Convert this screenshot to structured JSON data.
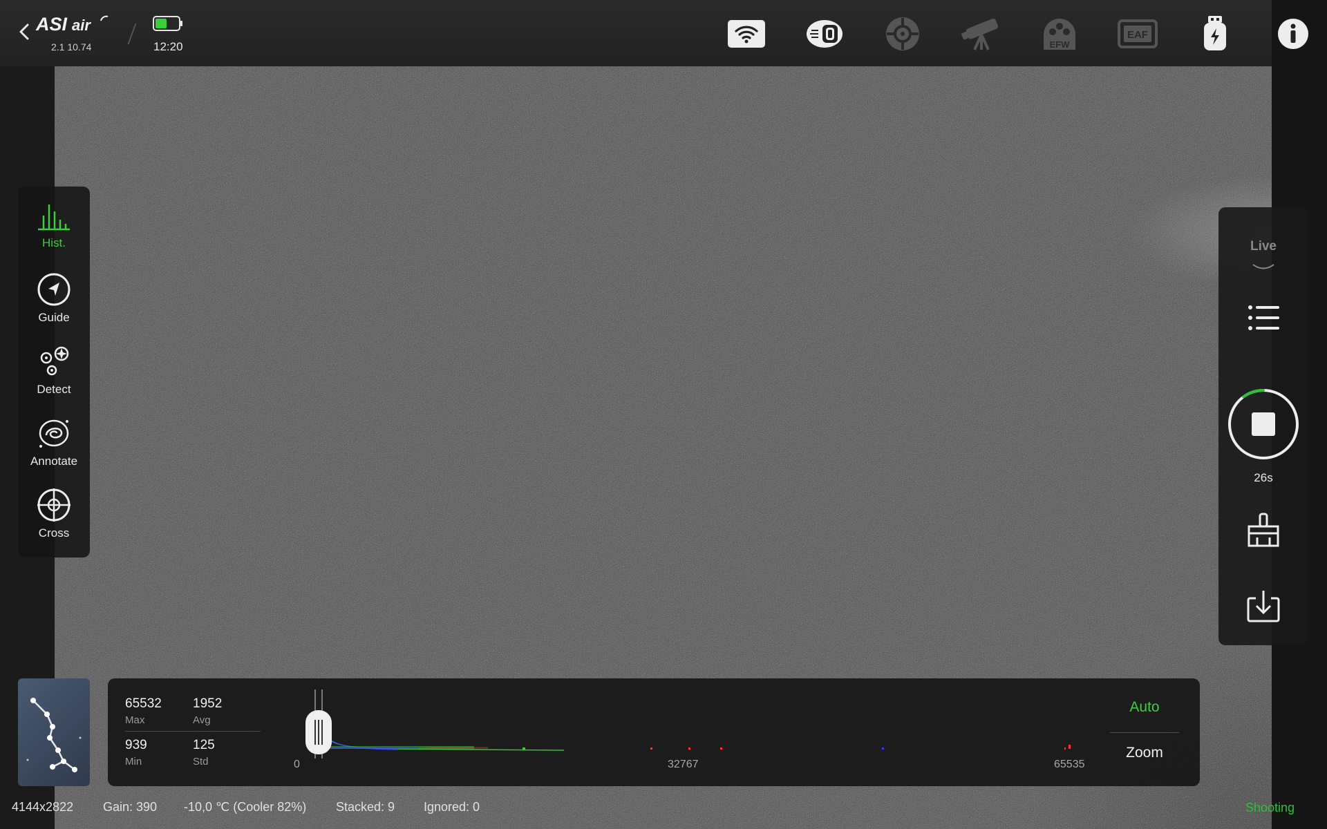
{
  "app": {
    "logo": "ASIair",
    "version": "2.1 10.74",
    "time": "12:20",
    "battery_color": "#3ccf3c"
  },
  "topbar_icons": [
    "wifi-icon",
    "camera-icon",
    "guide-scope-icon",
    "telescope-icon",
    "efw-icon",
    "eaf-icon",
    "usb-drive-icon",
    "info-icon"
  ],
  "topbar_labels": {
    "efw": "EFW",
    "eaf": "EAF"
  },
  "left_tools": [
    {
      "label": "Hist.",
      "icon": "histogram-icon",
      "active": true
    },
    {
      "label": "Guide",
      "icon": "guide-icon",
      "active": false
    },
    {
      "label": "Detect",
      "icon": "detect-icon",
      "active": false
    },
    {
      "label": "Annotate",
      "icon": "annotate-icon",
      "active": false
    },
    {
      "label": "Cross",
      "icon": "crosshair-icon",
      "active": false
    }
  ],
  "right_panel": {
    "mode": "Live",
    "countdown": "26s",
    "exposure_progress": 0.1,
    "icons": [
      "list-icon",
      "stop-icon",
      "broom-icon",
      "download-icon"
    ]
  },
  "histogram": {
    "max": "65532",
    "max_label": "Max",
    "avg": "1952",
    "avg_label": "Avg",
    "min": "939",
    "min_label": "Min",
    "std": "125",
    "std_label": "Std",
    "tick_min": "0",
    "tick_mid": "32767",
    "tick_max": "65535",
    "auto_label": "Auto",
    "zoom_label": "Zoom"
  },
  "status": {
    "resolution": "4144x2822",
    "gain": "Gain: 390",
    "temperature": "-10,0 ℃ (Cooler 82%)",
    "stacked": "Stacked: 9",
    "ignored": "Ignored: 0",
    "state": "Shooting"
  }
}
